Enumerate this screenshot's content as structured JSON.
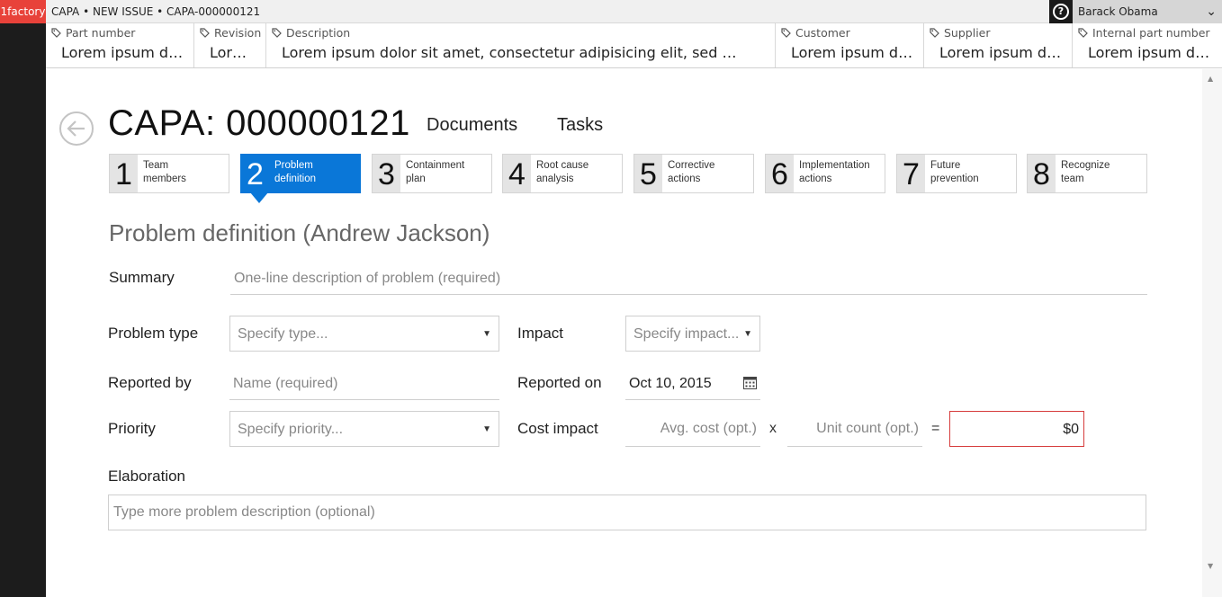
{
  "topbar": {
    "brand": "1factory",
    "breadcrumb": "CAPA • NEW ISSUE • CAPA-000000121",
    "help_glyph": "?",
    "user_name": "Barack Obama"
  },
  "attributes": [
    {
      "label": "Part number",
      "value": "Lorem ipsum d…"
    },
    {
      "label": "Revision",
      "value": "Lor…"
    },
    {
      "label": "Description",
      "value": "Lorem ipsum dolor sit amet, consectetur adipisicing elit, sed …"
    },
    {
      "label": "Customer",
      "value": "Lorem ipsum d…"
    },
    {
      "label": "Supplier",
      "value": "Lorem ipsum d…"
    },
    {
      "label": "Internal part number",
      "value": "Lorem ipsum d…"
    }
  ],
  "page": {
    "title": "CAPA: 000000121",
    "nav": [
      "Documents",
      "Tasks"
    ]
  },
  "steps": [
    {
      "num": "1",
      "line1": "Team",
      "line2": "members",
      "active": false
    },
    {
      "num": "2",
      "line1": "Problem",
      "line2": "definition",
      "active": true
    },
    {
      "num": "3",
      "line1": "Containment",
      "line2": "plan",
      "active": false
    },
    {
      "num": "4",
      "line1": "Root cause",
      "line2": "analysis",
      "active": false
    },
    {
      "num": "5",
      "line1": "Corrective",
      "line2": "actions",
      "active": false
    },
    {
      "num": "6",
      "line1": "Implementation",
      "line2": "actions",
      "active": false
    },
    {
      "num": "7",
      "line1": "Future",
      "line2": "prevention",
      "active": false
    },
    {
      "num": "8",
      "line1": "Recognize",
      "line2": "team",
      "active": false
    }
  ],
  "form": {
    "section_title": "Problem definition (Andrew Jackson)",
    "summary_label": "Summary",
    "summary_placeholder": "One-line description of problem (required)",
    "problem_type_label": "Problem type",
    "problem_type_placeholder": "Specify type...",
    "impact_label": "Impact",
    "impact_placeholder": "Specify impact...",
    "reported_by_label": "Reported by",
    "reported_by_placeholder": "Name (required)",
    "reported_on_label": "Reported on",
    "reported_on_value": "Oct 10, 2015",
    "priority_label": "Priority",
    "priority_placeholder": "Specify priority...",
    "cost_impact_label": "Cost impact",
    "avg_cost_placeholder": "Avg. cost (opt.)",
    "times_sign": "x",
    "unit_count_placeholder": "Unit count (opt.)",
    "equals_sign": "=",
    "cost_total": "$0",
    "elaboration_label": "Elaboration",
    "elaboration_placeholder": "Type more problem description (optional)"
  },
  "colors": {
    "brand": "#e8423a",
    "active_step": "#0a77d8",
    "error_border": "#d63c3c"
  }
}
